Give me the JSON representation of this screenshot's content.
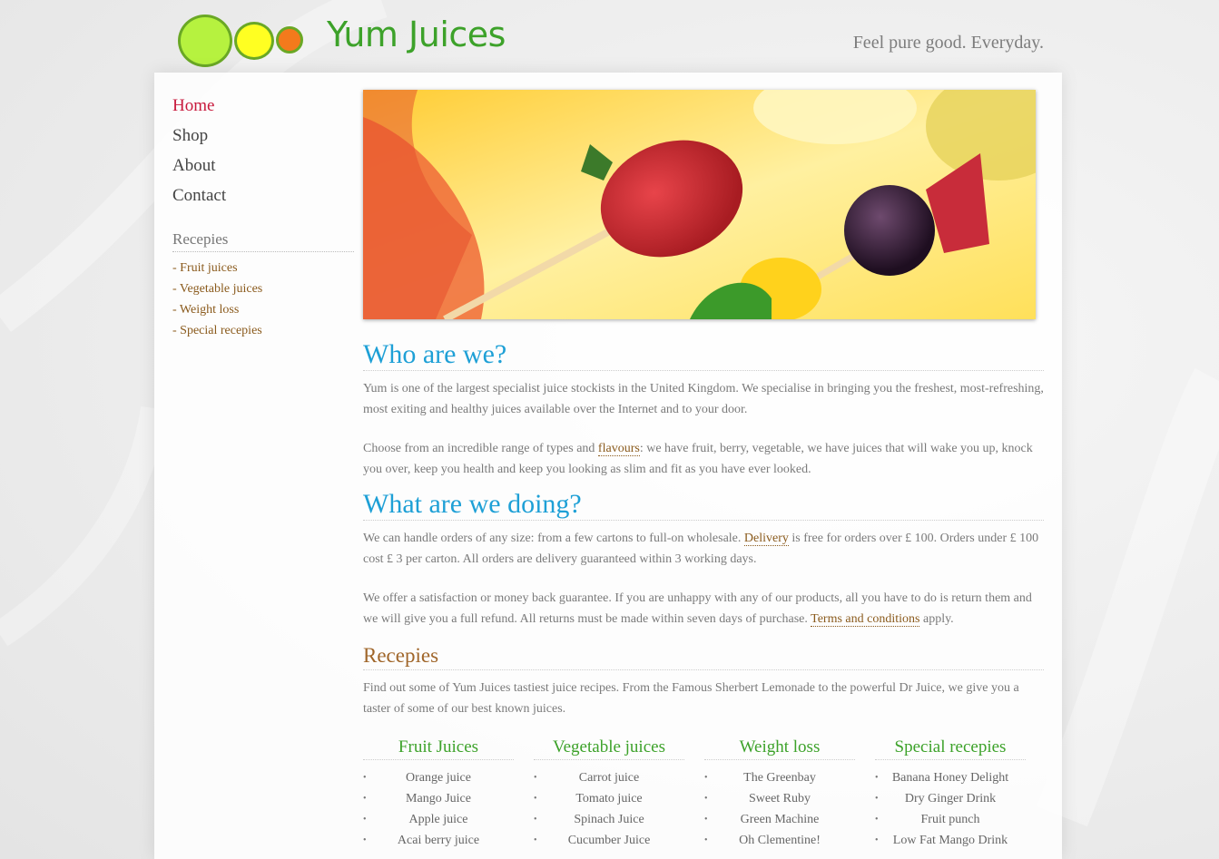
{
  "header": {
    "logo_text": "Yum Juices",
    "tagline": "Feel pure good. Everyday."
  },
  "nav": {
    "items": [
      {
        "label": "Home"
      },
      {
        "label": "Shop"
      },
      {
        "label": "About"
      },
      {
        "label": "Contact"
      }
    ]
  },
  "sidebar": {
    "recipes_title": "Recepies",
    "recipes": [
      {
        "label": "- Fruit juices"
      },
      {
        "label": "- Vegetable juices"
      },
      {
        "label": "- Weight loss"
      },
      {
        "label": "- Special recepies"
      }
    ]
  },
  "main": {
    "who_title": "Who are we?",
    "who_p1": "Yum is one of the largest specialist juice stockists in the United Kingdom. We specialise in bringing you the freshest, most-refreshing, most exiting and healthy juices available over the Internet and to your door.",
    "who_p2_before": "Choose from an incredible range of types and ",
    "who_p2_link": "flavours",
    "who_p2_after": ": we have fruit, berry, vegetable, we have juices that will wake you up, knock you over, keep you health and keep you looking as slim and fit as you have ever looked.",
    "doing_title": "What are we doing?",
    "doing_p1_before": "We can handle orders of any size: from a few cartons to full-on wholesale. ",
    "doing_p1_link": "Delivery",
    "doing_p1_after": " is free for orders over £ 100. Orders under £ 100 cost £ 3 per carton. All orders are delivery guaranteed within 3 working days.",
    "doing_p2_before": "We offer a satisfaction or money back guarantee. If you are unhappy with any of our products, all you have to do is return them and we will give you a full refund. All returns must be made within seven days of purchase. ",
    "doing_p2_link": "Terms and conditions",
    "doing_p2_after": " apply.",
    "recipes_title": "Recepies",
    "recipes_p": "Find out some of Yum Juices tastiest juice recipes. From the Famous Sherbert Lemonade to the powerful Dr Juice, we give you a taster of some of our best known juices.",
    "columns": [
      {
        "title": "Fruit Juices",
        "items": [
          "Orange juice",
          "Mango Juice",
          "Apple juice",
          "Acai berry juice"
        ]
      },
      {
        "title": "Vegetable juices",
        "items": [
          "Carrot juice",
          "Tomato juice",
          "Spinach Juice",
          "Cucumber Juice"
        ]
      },
      {
        "title": "Weight loss",
        "items": [
          "The Greenbay",
          "Sweet Ruby",
          "Green Machine",
          "Oh Clementine!"
        ]
      },
      {
        "title": "Special recepies",
        "items": [
          "Banana Honey Delight",
          "Dry Ginger Drink",
          "Fruit punch",
          "Low Fat Mango Drink"
        ]
      }
    ]
  },
  "colors": {
    "accent_blue": "#1ea0d6",
    "brand_green": "#3da22a",
    "active_nav": "#c8193c",
    "link_brown": "#8a5a1c"
  }
}
